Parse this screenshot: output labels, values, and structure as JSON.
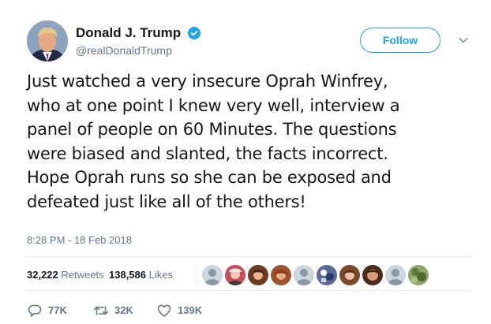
{
  "author": {
    "display_name": "Donald J. Trump",
    "handle": "@realDonaldTrump",
    "verified": true
  },
  "follow_button": {
    "label": "Follow"
  },
  "tweet": {
    "text": "Just watched a very insecure Oprah Winfrey,\nwho at one point I knew very well, interview a\npanel of people on 60 Minutes. The questions\nwere biased and slanted, the facts incorrect.\nHope Oprah runs so she can be exposed and\ndefeated just like all of the others!",
    "timestamp": "8:28 PM - 18 Feb 2018"
  },
  "stats": {
    "retweets_count": "32,222",
    "retweets_label": "Retweets",
    "likes_count": "138,586",
    "likes_label": "Likes"
  },
  "actions": {
    "reply_count": "77K",
    "retweet_count": "32K",
    "like_count": "139K"
  },
  "colors": {
    "accent": "#1da1f2",
    "text": "#14171a",
    "secondary": "#657786",
    "divider": "#e6ecf0"
  },
  "icons": {
    "verified": "verified-badge-icon",
    "caret": "chevron-down-icon",
    "reply": "reply-icon",
    "retweet": "retweet-icon",
    "like": "heart-icon"
  }
}
